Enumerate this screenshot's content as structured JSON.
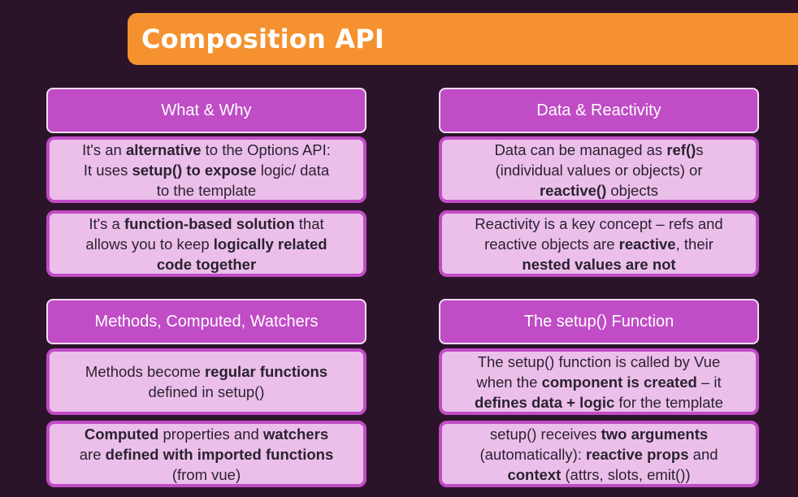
{
  "slide": {
    "title": "Composition API"
  },
  "colors": {
    "background": "#2b1429",
    "title_bar": "#f5922f",
    "header_fill": "#c04cc6",
    "card_fill": "#ecbfeb",
    "card_border": "#c04cc6"
  },
  "sections": {
    "what_why": {
      "header": "What & Why",
      "card1": {
        "l1a": "It's an ",
        "l1b": "alternative",
        "l1c": " to the Options API:",
        "l2a": "It uses ",
        "l2b": "setup() to expose",
        "l2c": " logic/ data",
        "l3a": "to the template"
      },
      "card2": {
        "l1a": "It's a ",
        "l1b": "function-based solution",
        "l1c": " that",
        "l2a": "allows you to keep ",
        "l2b": "logically related",
        "l3b": "code together"
      }
    },
    "data_reactivity": {
      "header": "Data & Reactivity",
      "card1": {
        "l1a": "Data can be managed as ",
        "l1b": "ref()",
        "l1c": "s",
        "l2a": "(individual values or objects) or",
        "l3b": "reactive()",
        "l3c": " objects"
      },
      "card2": {
        "l1a": "Reactivity is a key concept – refs and",
        "l2a": "reactive objects are ",
        "l2b": "reactive",
        "l2c": ", their",
        "l3b": "nested values are not"
      }
    },
    "methods": {
      "header": "Methods, Computed, Watchers",
      "card1": {
        "l1a": "Methods become ",
        "l1b": "regular functions",
        "l2a": "defined in setup()"
      },
      "card2": {
        "l1b": "Computed",
        "l1c": " properties and ",
        "l1d": "watchers",
        "l2a": "are ",
        "l2b": "defined with imported functions",
        "l3a": "(from vue)"
      }
    },
    "setup_fn": {
      "header": "The setup() Function",
      "card1": {
        "l1a": "The setup() function is called by Vue",
        "l2a": "when the ",
        "l2b": "component is created",
        "l2c": " – it",
        "l3b": "defines data + logic",
        "l3c": " for the template"
      },
      "card2": {
        "l1a": "setup() receives ",
        "l1b": "two arguments",
        "l2a": "(automatically): ",
        "l2b": "reactive props",
        "l2c": " and",
        "l3b": "context",
        "l3c": " (attrs, slots, emit())"
      }
    }
  }
}
